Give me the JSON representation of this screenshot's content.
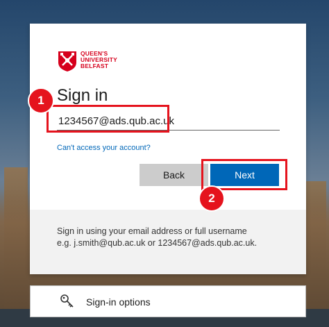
{
  "logo": {
    "line1": "QUEEN'S",
    "line2": "UNIVERSITY",
    "line3": "BELFAST"
  },
  "signin": {
    "title": "Sign in",
    "email_value": "1234567@ads.qub.ac.uk",
    "cant_access": "Can't access your account?",
    "back_label": "Back",
    "next_label": "Next"
  },
  "info": {
    "line1": "Sign in using your email address or full username",
    "line2": "e.g. j.smith@qub.ac.uk or 1234567@ads.qub.ac.uk."
  },
  "options": {
    "label": "Sign-in options",
    "icon": "key-icon"
  },
  "annotations": {
    "badge1": "1",
    "badge2": "2"
  },
  "colors": {
    "accent": "#0067b8",
    "brand": "#d6001c",
    "highlight": "#e5131d"
  }
}
